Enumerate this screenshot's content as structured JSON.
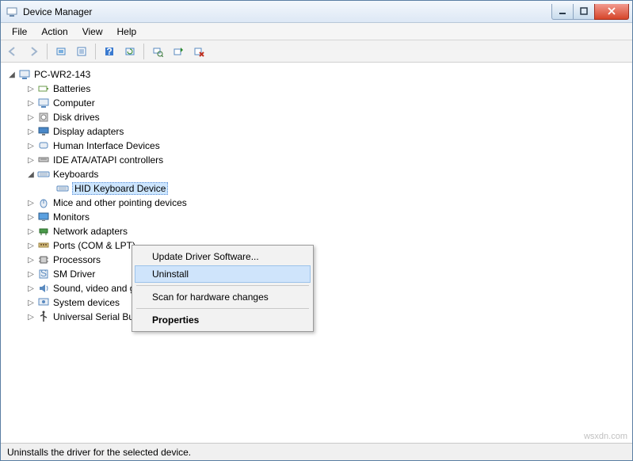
{
  "window": {
    "title": "Device Manager"
  },
  "menu": {
    "file": "File",
    "action": "Action",
    "view": "View",
    "help": "Help"
  },
  "toolbar": {
    "back": "back",
    "forward": "forward",
    "show_hidden": "show-hidden",
    "properties": "properties",
    "help": "help",
    "refresh": "refresh",
    "scan": "scan",
    "update": "update-driver",
    "uninstall": "uninstall"
  },
  "tree": {
    "root": "PC-WR2-143",
    "items": [
      {
        "label": "Batteries",
        "icon": "battery"
      },
      {
        "label": "Computer",
        "icon": "computer"
      },
      {
        "label": "Disk drives",
        "icon": "disk"
      },
      {
        "label": "Display adapters",
        "icon": "display"
      },
      {
        "label": "Human Interface Devices",
        "icon": "hid"
      },
      {
        "label": "IDE ATA/ATAPI controllers",
        "icon": "ide"
      },
      {
        "label": "Keyboards",
        "icon": "keyboard",
        "expanded": true,
        "children": [
          {
            "label": "HID Keyboard Device",
            "icon": "keyboard",
            "selected": true
          }
        ]
      },
      {
        "label": "Mice and other pointing devices",
        "icon": "mouse"
      },
      {
        "label": "Monitors",
        "icon": "monitor"
      },
      {
        "label": "Network adapters",
        "icon": "network"
      },
      {
        "label": "Ports (COM & LPT)",
        "icon": "port"
      },
      {
        "label": "Processors",
        "icon": "cpu"
      },
      {
        "label": "SM Driver",
        "icon": "sm"
      },
      {
        "label": "Sound, video and game controllers",
        "icon": "sound"
      },
      {
        "label": "System devices",
        "icon": "system"
      },
      {
        "label": "Universal Serial Bus controllers",
        "icon": "usb"
      }
    ]
  },
  "context_menu": {
    "update": "Update Driver Software...",
    "uninstall": "Uninstall",
    "scan": "Scan for hardware changes",
    "properties": "Properties"
  },
  "status": "Uninstalls the driver for the selected device.",
  "watermark": "wsxdn.com"
}
